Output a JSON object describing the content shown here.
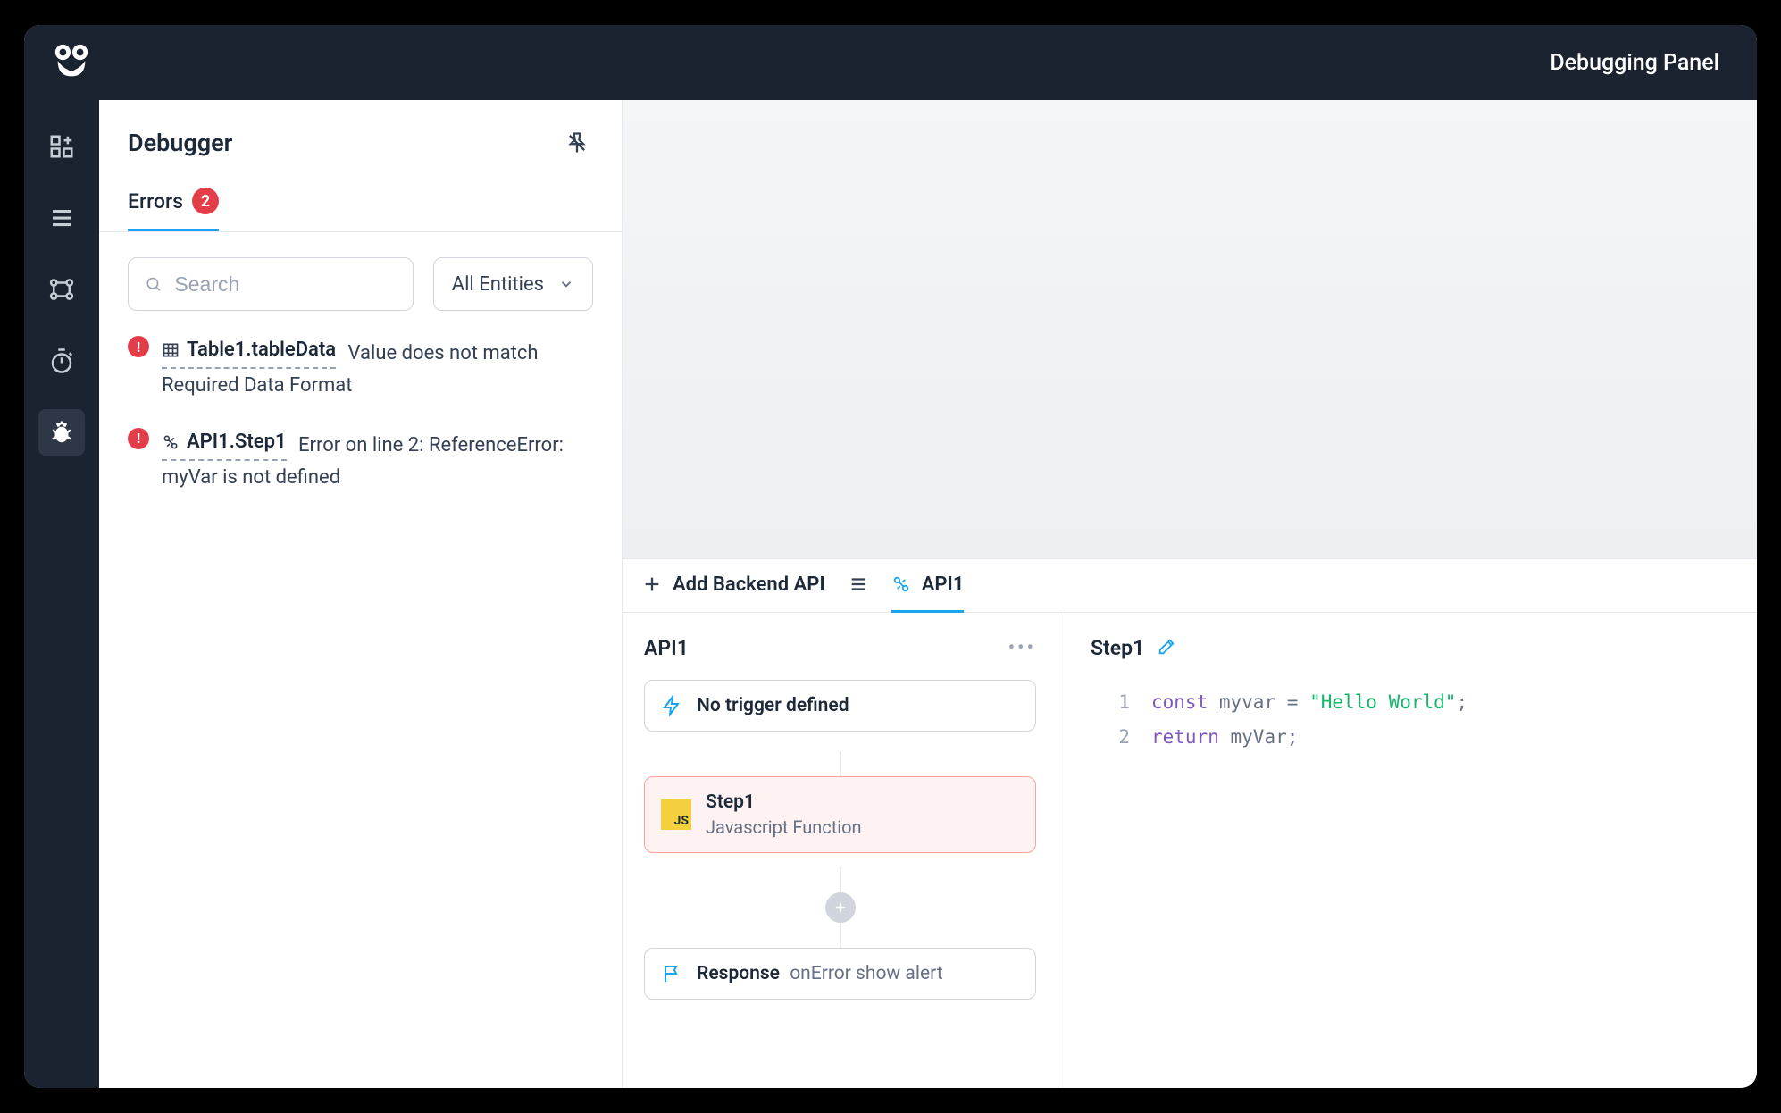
{
  "header": {
    "title": "Debugging Panel"
  },
  "sidebar": {
    "rail": [
      {
        "name": "add-widget-icon"
      },
      {
        "name": "menu-icon"
      },
      {
        "name": "queries-icon"
      },
      {
        "name": "stopwatch-icon"
      },
      {
        "name": "bug-icon",
        "active": true
      }
    ]
  },
  "debugger": {
    "title": "Debugger",
    "tab_errors_label": "Errors",
    "error_count": "2",
    "search_placeholder": "Search",
    "filter_label": "All Entities",
    "errors": [
      {
        "entity": "Table1.tableData",
        "type_icon": "table-icon",
        "message": "Value does not match Required Data Format"
      },
      {
        "entity": "API1.Step1",
        "type_icon": "api-icon",
        "message": "Error on line 2: ReferenceError: myVar is not defined"
      }
    ]
  },
  "bottom": {
    "add_label": "Add Backend API",
    "active_api": "API1",
    "panel_title": "API1",
    "trigger": {
      "label": "No trigger defined"
    },
    "step": {
      "title": "Step1",
      "subtitle": "Javascript Function"
    },
    "response": {
      "label": "Response",
      "sub": "onError show alert"
    },
    "editor": {
      "title": "Step1",
      "lines": [
        {
          "n": "1",
          "tokens": [
            "const",
            " ",
            "myvar",
            " ",
            "=",
            " ",
            "\"Hello World\"",
            ";"
          ]
        },
        {
          "n": "2",
          "tokens": [
            "return",
            " ",
            "myVar",
            ";"
          ]
        }
      ]
    }
  }
}
